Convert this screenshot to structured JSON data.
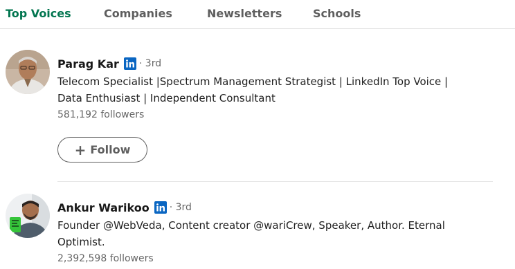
{
  "tabs": [
    {
      "label": "Top Voices",
      "active": true
    },
    {
      "label": "Companies",
      "active": false
    },
    {
      "label": "Newsletters",
      "active": false
    },
    {
      "label": "Schools",
      "active": false
    }
  ],
  "people": [
    {
      "name": "Parag Kar",
      "degree": "· 3rd",
      "headline_line1": "Telecom Specialist |Spectrum Management Strategist | LinkedIn Top Voice |",
      "headline_line2": "Data Enthusiast | Independent Consultant",
      "followers": "581,192 followers",
      "follow_label": "Follow"
    },
    {
      "name": "Ankur Warikoo",
      "degree": "· 3rd",
      "headline_line1": "Founder @WebVeda, Content creator @wariCrew, Speaker, Author. Eternal",
      "headline_line2": "Optimist.",
      "followers": "2,392,598 followers"
    }
  ],
  "colors": {
    "active_tab": "#01754f",
    "linkedin_blue": "#0a66c2",
    "muted_text": "#666666"
  },
  "icons": {
    "badge": "linkedin-icon",
    "follow": "plus-icon"
  }
}
